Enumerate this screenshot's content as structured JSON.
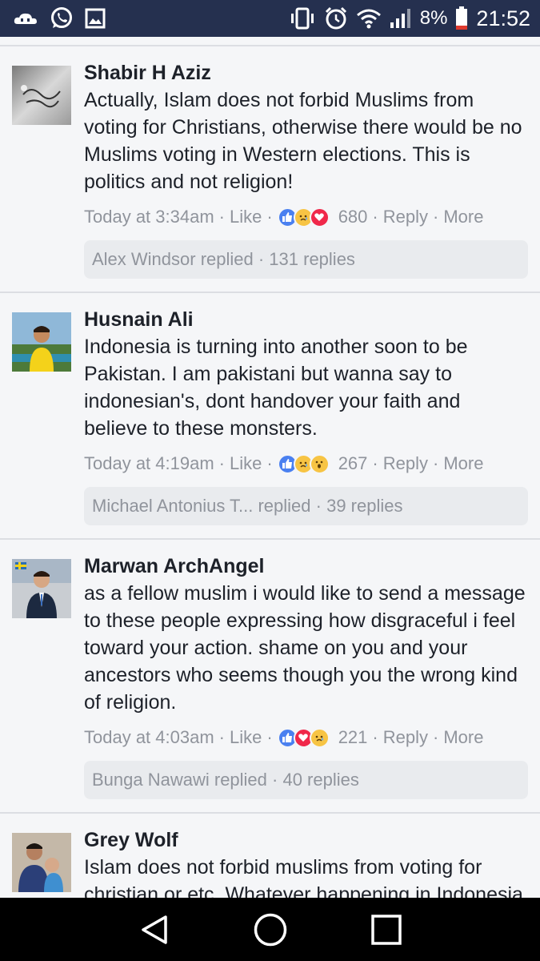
{
  "status_bar": {
    "battery_percent": "8%",
    "time": "21:52",
    "icons": [
      "cloud-icon",
      "whatsapp-icon",
      "gallery-icon",
      "vibrate-icon",
      "alarm-icon",
      "wifi-icon",
      "signal-icon",
      "battery-icon"
    ]
  },
  "comments": [
    {
      "author": "Shabir H Aziz",
      "text": "Actually, Islam does not forbid Muslims from voting for Christians, otherwise there would be no Muslims voting in Western elections. This is politics and not religion!",
      "time": "Today at 3:34am",
      "like": "Like",
      "reactions": [
        "like",
        "sad",
        "love"
      ],
      "reaction_count": "680",
      "reply": "Reply",
      "more": "More",
      "replies_summary": "Alex Windsor replied · 131 replies"
    },
    {
      "author": "Husnain Ali",
      "text": "Indonesia is turning into another soon to be Pakistan. I am pakistani but wanna say to indonesian's, dont handover your faith and believe to these monsters.",
      "time": "Today at 4:19am",
      "like": "Like",
      "reactions": [
        "like",
        "sad",
        "wow"
      ],
      "reaction_count": "267",
      "reply": "Reply",
      "more": "More",
      "replies_summary": "Michael Antonius T... replied · 39 replies"
    },
    {
      "author": "Marwan ArchAngel",
      "text": "as a fellow muslim i would like to send a message to these people expressing how disgraceful i feel toward your action. shame on you and your ancestors who seems though you the wrong kind of religion.",
      "time": "Today at 4:03am",
      "like": "Like",
      "reactions": [
        "like",
        "love",
        "sad"
      ],
      "reaction_count": "221",
      "reply": "Reply",
      "more": "More",
      "replies_summary": "Bunga Nawawi replied · 40 replies"
    },
    {
      "author": "Grey Wolf",
      "text": "Islam does not forbid muslims from voting for christian or etc. Whatever happening in Indonesia is evil politics. It got nothing to do"
    }
  ],
  "colors": {
    "status_bar": "#25304f",
    "like_blue": "#4a80f0",
    "love_red": "#f0284a",
    "emoji_yellow": "#f7c444",
    "meta_grey": "#90949c"
  }
}
